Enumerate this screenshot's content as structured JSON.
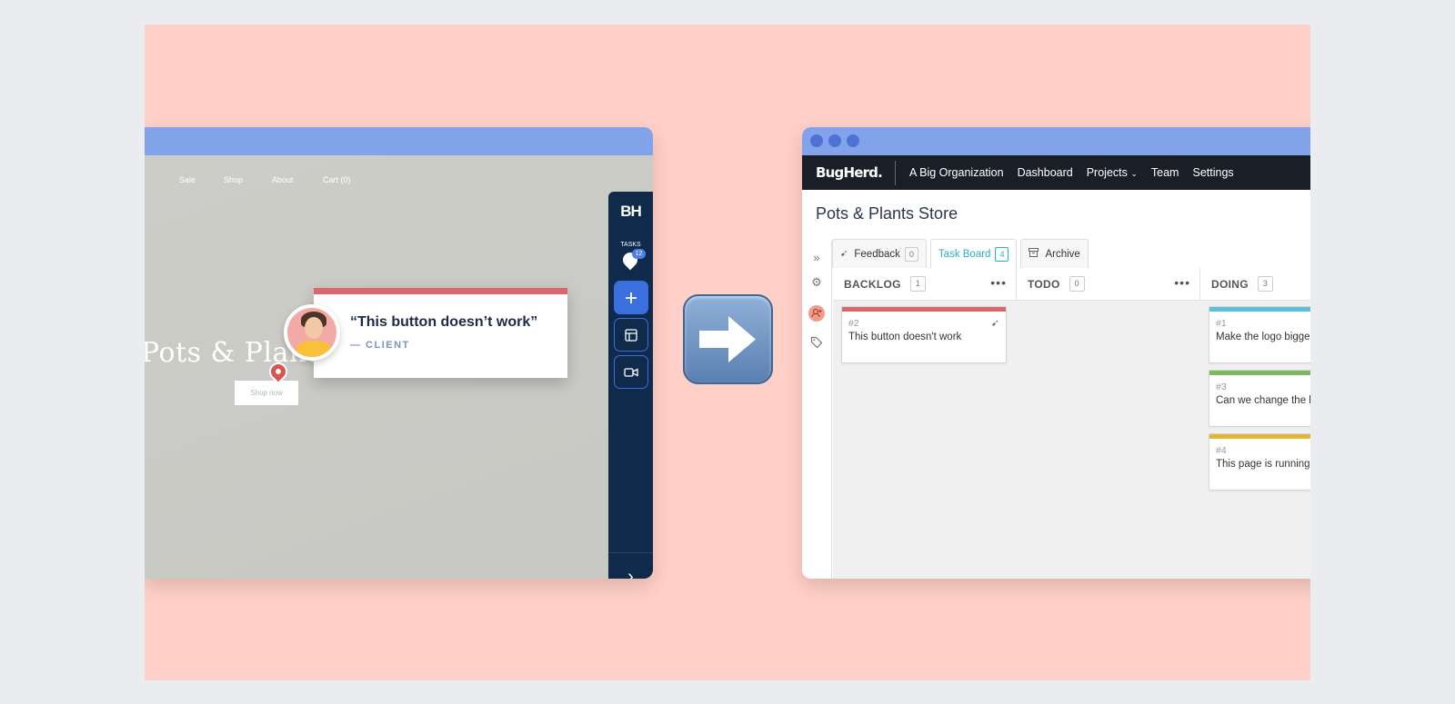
{
  "left_site": {
    "nav": [
      "Sale",
      "Shop",
      "About",
      "Cart (0)"
    ],
    "hero_title": "Pots & Plants",
    "shop_button": "Shop now",
    "comment": {
      "quote": "“This button doesn’t work”",
      "author": "— CLIENT"
    },
    "sidebar": {
      "logo": "BH",
      "tasks_label": "TASKS",
      "tasks_count": "12"
    }
  },
  "right_app": {
    "brand": "BugHerd.",
    "nav": [
      "A Big Organization",
      "Dashboard",
      "Projects",
      "Team",
      "Settings"
    ],
    "project_title": "Pots & Plants Store",
    "tabs": [
      {
        "label": "Feedback",
        "count": "0"
      },
      {
        "label": "Task Board",
        "count": "4",
        "active": true
      },
      {
        "label": "Archive"
      }
    ],
    "columns": [
      {
        "name": "BACKLOG",
        "count": "1"
      },
      {
        "name": "TODO",
        "count": "0"
      },
      {
        "name": "DOING",
        "count": "3"
      }
    ],
    "cards": [
      {
        "num": "#2",
        "title": "This button doesn't work",
        "color": "#d9676b"
      },
      {
        "num": "#1",
        "title": "Make the logo bigge",
        "color": "#5bc0d8"
      },
      {
        "num": "#3",
        "title": "Can we change the h",
        "color": "#7cb85c"
      },
      {
        "num": "#4",
        "title": "This page is running",
        "color": "#e5b630"
      }
    ]
  }
}
